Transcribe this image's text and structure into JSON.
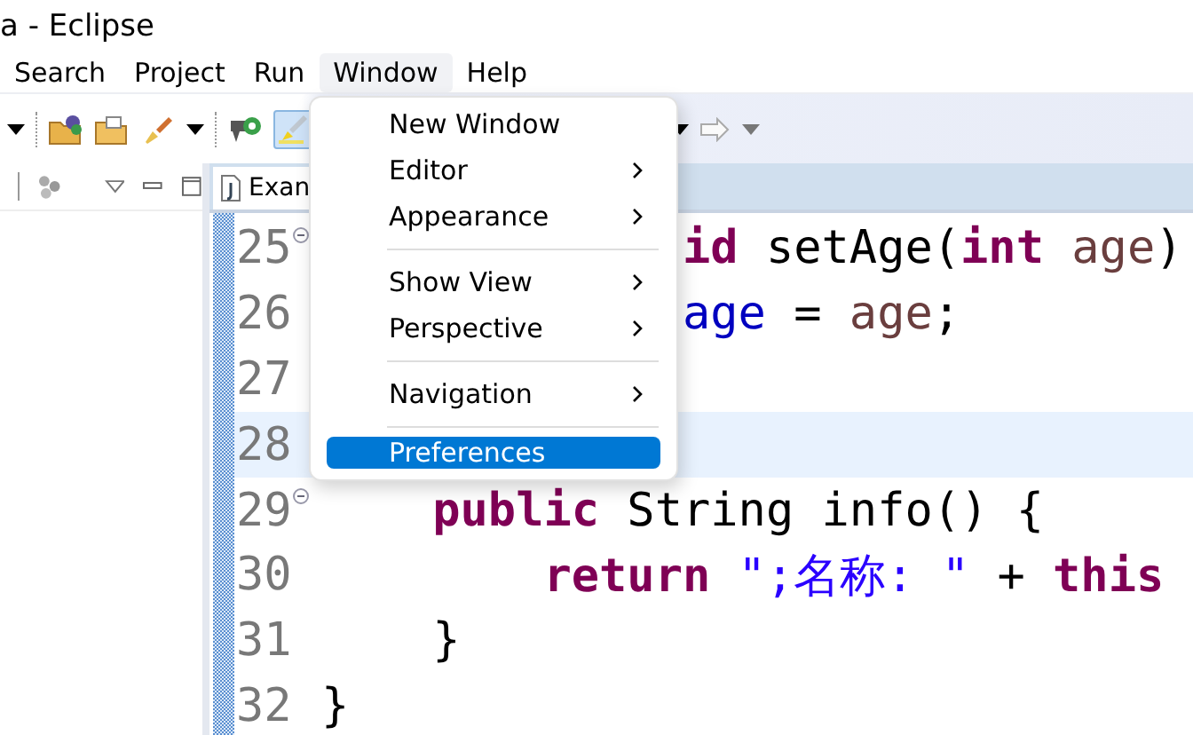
{
  "window": {
    "title": "a - Eclipse"
  },
  "menubar": [
    {
      "label": "Search",
      "selected": false
    },
    {
      "label": "Project",
      "selected": false
    },
    {
      "label": "Run",
      "selected": false
    },
    {
      "label": "Window",
      "selected": true
    },
    {
      "label": "Help",
      "selected": false
    }
  ],
  "toolbar": {
    "highlight_on": true
  },
  "editor": {
    "tab": {
      "label": "Exan"
    },
    "lines": [
      {
        "number": "25",
        "fold": true,
        "current": false,
        "tokens": [
          {
            "kind": "keyword",
            "text": "id"
          },
          {
            "kind": "plain",
            "text": " setAge("
          },
          {
            "kind": "keyword",
            "text": "int"
          },
          {
            "kind": "param",
            "text": " age"
          },
          {
            "kind": "plain",
            "text": ")"
          }
        ]
      },
      {
        "number": "26",
        "fold": false,
        "current": false,
        "tokens": [
          {
            "kind": "field",
            "text": "age"
          },
          {
            "kind": "plain",
            "text": " = "
          },
          {
            "kind": "param",
            "text": "age"
          },
          {
            "kind": "plain",
            "text": ";"
          }
        ]
      },
      {
        "number": "27",
        "fold": false,
        "current": false
      },
      {
        "number": "28",
        "fold": false,
        "current": true
      },
      {
        "number": "29",
        "fold": true,
        "current": false,
        "tokens": [
          {
            "kind": "keyword",
            "text": "public"
          },
          {
            "kind": "plain",
            "text": " String info() {"
          }
        ]
      },
      {
        "number": "30",
        "fold": false,
        "current": false,
        "tokens": [
          {
            "kind": "keyword",
            "text": "return"
          },
          {
            "kind": "string",
            "text": " \";名称: \""
          },
          {
            "kind": "plain",
            "text": " + "
          },
          {
            "kind": "keyword",
            "text": "this"
          }
        ]
      },
      {
        "number": "31",
        "fold": false,
        "current": false,
        "tokens": [
          {
            "kind": "plain",
            "text": "}"
          }
        ]
      },
      {
        "number": "32",
        "fold": false,
        "current": false,
        "tokens": [
          {
            "kind": "plain",
            "text": "}"
          }
        ]
      }
    ]
  },
  "menu": [
    {
      "kind": "item",
      "label": "New Window",
      "submenu": false,
      "selected": false
    },
    {
      "kind": "item",
      "label": "Editor",
      "submenu": true,
      "selected": false
    },
    {
      "kind": "item",
      "label": "Appearance",
      "submenu": true,
      "selected": false
    },
    {
      "kind": "separator"
    },
    {
      "kind": "item",
      "label": "Show View",
      "submenu": true,
      "selected": false
    },
    {
      "kind": "item",
      "label": "Perspective",
      "submenu": true,
      "selected": false
    },
    {
      "kind": "separator"
    },
    {
      "kind": "item",
      "label": "Navigation",
      "submenu": true,
      "selected": false
    },
    {
      "kind": "separator"
    },
    {
      "kind": "item",
      "label": "Preferences",
      "submenu": false,
      "selected": true
    }
  ]
}
